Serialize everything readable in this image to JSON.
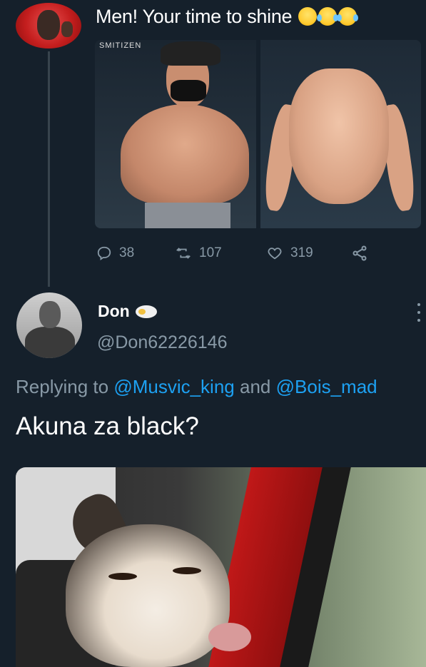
{
  "tweet1": {
    "text": "Men! Your time to shine",
    "emojis": [
      "relieved-face",
      "tears-of-joy",
      "tears-of-joy"
    ],
    "image_left_watermark": "SMITIZEN",
    "actions": {
      "reply_count": "38",
      "retweet_count": "107",
      "like_count": "319"
    }
  },
  "tweet2": {
    "display_name": "Don",
    "handle": "@Don62226146",
    "replying_prefix": "Replying to",
    "reply_to_1": "@Musvic_king",
    "reply_conjunction": "and",
    "reply_to_2": "@Bois_mad",
    "text": "Akuna za black?"
  },
  "colors": {
    "background": "#15202b",
    "muted": "#8899a6",
    "link": "#1da1f2",
    "thread_line": "#38444d"
  }
}
